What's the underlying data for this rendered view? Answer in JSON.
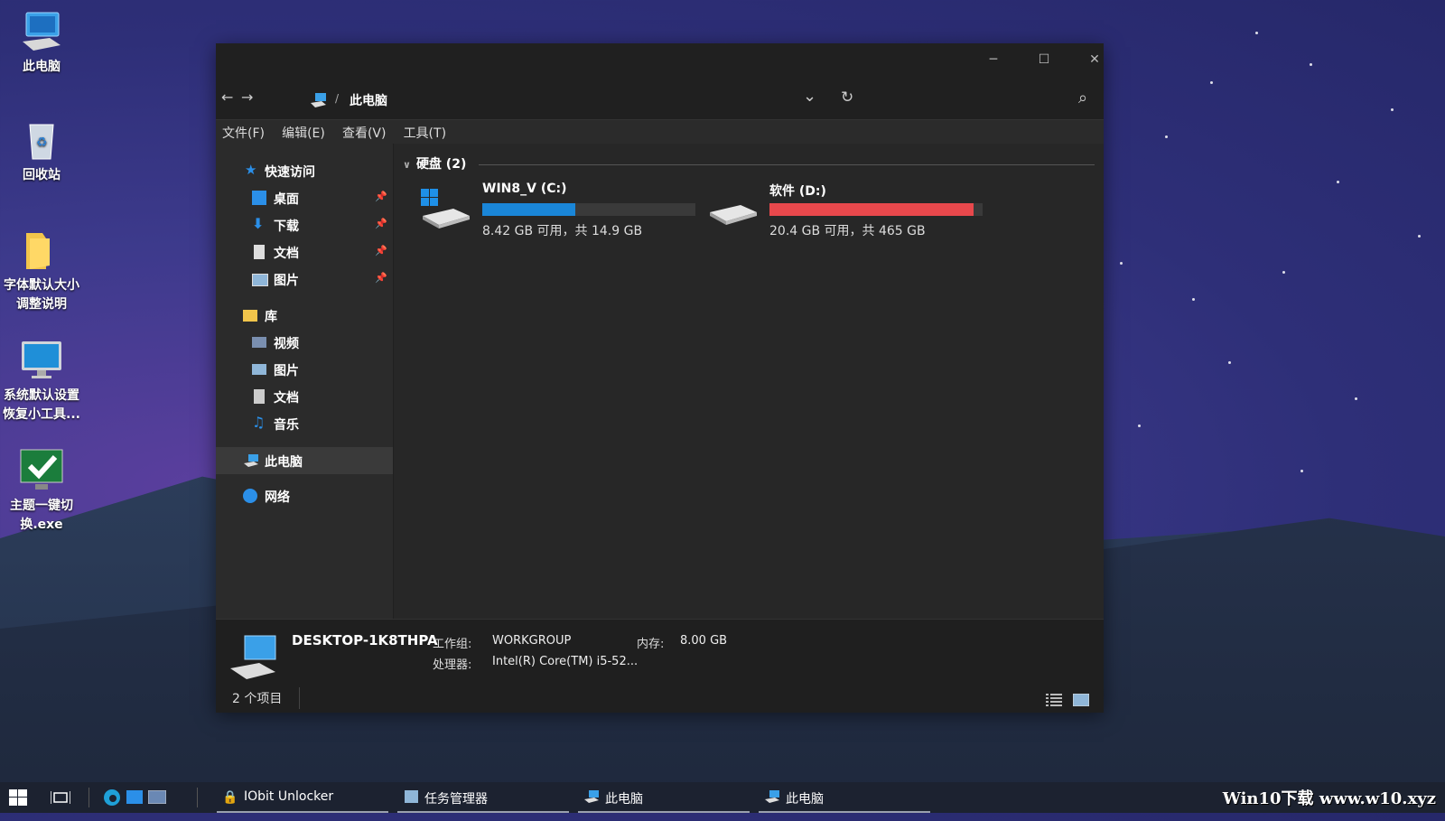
{
  "desktop": {
    "icons": [
      {
        "label": "此电脑",
        "icon": "computer-icon"
      },
      {
        "label": "回收站",
        "icon": "recycle-bin-icon"
      },
      {
        "label": "字体默认大小调整说明",
        "line1": "字体默认大小",
        "line2": "调整说明",
        "icon": "folder-icon"
      },
      {
        "label": "系统默认设置恢复小工具...",
        "line1": "系统默认设置",
        "line2": "恢复小工具...",
        "icon": "monitor-icon"
      },
      {
        "label": "主题一键切换.exe",
        "line1": "主题一键切",
        "line2": "换.exe",
        "icon": "checkmark-monitor-icon"
      }
    ]
  },
  "window": {
    "controls": {
      "minimize": "─",
      "maximize": "☐",
      "close": "✕"
    },
    "address": {
      "back": "←",
      "forward": "→",
      "separator": "/",
      "location": "此电脑",
      "dropdown": "⌄",
      "refresh": "↻",
      "search": "⌕"
    },
    "menu": [
      "文件(F)",
      "编辑(E)",
      "查看(V)",
      "工具(T)"
    ],
    "sidebar": {
      "quick_access": "快速访问",
      "quick_items": [
        "桌面",
        "下载",
        "文档",
        "图片"
      ],
      "library": "库",
      "library_items": [
        "视频",
        "图片",
        "文档",
        "音乐"
      ],
      "this_pc": "此电脑",
      "network": "网络",
      "pin": "📌"
    },
    "content": {
      "group_label": "硬盘 (2)",
      "drives": [
        {
          "name": "WIN8_V (C:)",
          "space": "8.42 GB 可用，共 14.9 GB",
          "used_fraction": 0.435,
          "bar_color": "#1a86d8"
        },
        {
          "name": "软件 (D:)",
          "space": "20.4 GB 可用，共 465 GB",
          "used_fraction": 0.956,
          "bar_color": "#e8484c"
        }
      ]
    },
    "details": {
      "computer_name": "DESKTOP-1K8THPA",
      "workgroup_label": "工作组:",
      "workgroup": "WORKGROUP",
      "memory_label": "内存:",
      "memory": "8.00 GB",
      "processor_label": "处理器:",
      "processor": "Intel(R) Core(TM) i5-52..."
    },
    "status": "2 个项目"
  },
  "taskbar": {
    "tasks": [
      "IObit Unlocker",
      "任务管理器",
      "此电脑",
      "此电脑"
    ],
    "watermark": "Win10下载 www.w10.xyz"
  }
}
